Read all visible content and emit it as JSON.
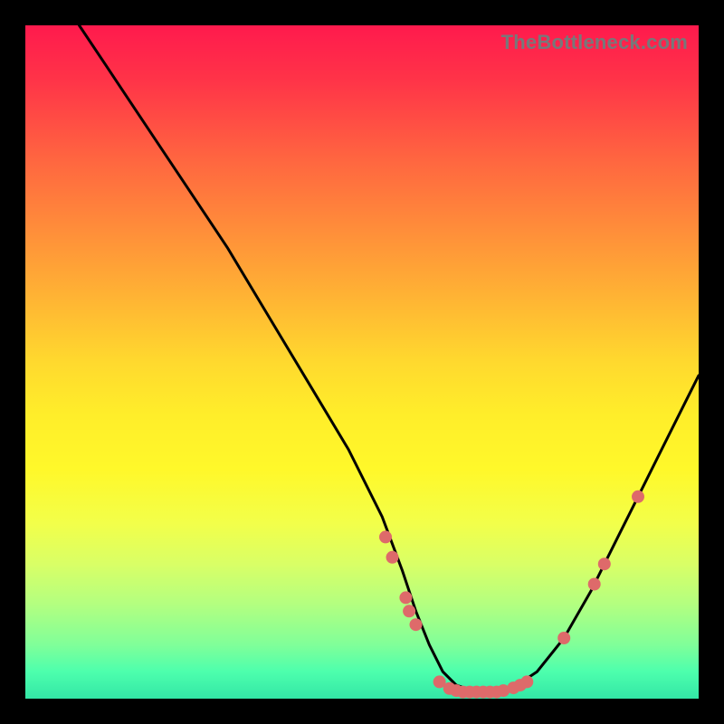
{
  "watermark": "TheBottleneck.com",
  "chart_data": {
    "type": "line",
    "title": "",
    "xlabel": "",
    "ylabel": "",
    "xlim": [
      0,
      100
    ],
    "ylim": [
      0,
      100
    ],
    "series": [
      {
        "name": "curve",
        "x": [
          8,
          12,
          18,
          24,
          30,
          36,
          42,
          48,
          53,
          56,
          58,
          60,
          62,
          64,
          67,
          70,
          73,
          76,
          80,
          84,
          88,
          92,
          96,
          100
        ],
        "y": [
          100,
          94,
          85,
          76,
          67,
          57,
          47,
          37,
          27,
          19,
          13,
          8,
          4,
          2,
          1,
          1,
          2,
          4,
          9,
          16,
          24,
          32,
          40,
          48
        ]
      }
    ],
    "markers": [
      {
        "x": 53.5,
        "y": 24
      },
      {
        "x": 54.5,
        "y": 21
      },
      {
        "x": 56.5,
        "y": 15
      },
      {
        "x": 57.0,
        "y": 13
      },
      {
        "x": 58.0,
        "y": 11
      },
      {
        "x": 61.5,
        "y": 2.5
      },
      {
        "x": 63.0,
        "y": 1.5
      },
      {
        "x": 64.0,
        "y": 1.2
      },
      {
        "x": 65.0,
        "y": 1.0
      },
      {
        "x": 66.0,
        "y": 1.0
      },
      {
        "x": 67.0,
        "y": 1.0
      },
      {
        "x": 68.0,
        "y": 1.0
      },
      {
        "x": 69.0,
        "y": 1.0
      },
      {
        "x": 70.0,
        "y": 1.0
      },
      {
        "x": 71.0,
        "y": 1.2
      },
      {
        "x": 72.5,
        "y": 1.6
      },
      {
        "x": 73.5,
        "y": 2.0
      },
      {
        "x": 74.5,
        "y": 2.5
      },
      {
        "x": 80.0,
        "y": 9.0
      },
      {
        "x": 84.5,
        "y": 17.0
      },
      {
        "x": 86.0,
        "y": 20.0
      },
      {
        "x": 91.0,
        "y": 30.0
      }
    ],
    "marker_color": "#de6a6a",
    "curve_color": "#000000"
  }
}
